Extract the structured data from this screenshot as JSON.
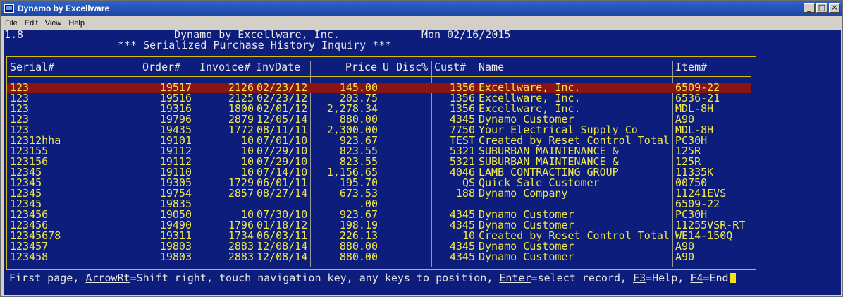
{
  "window": {
    "title": "Dynamo by Excellware",
    "icons": {
      "app": "terminal-app-icon",
      "minimize": "minimize-icon",
      "maximize": "maximize-icon",
      "close": "close-icon"
    },
    "buttons": {
      "minimize": "_",
      "maximize": "□",
      "close": "×"
    }
  },
  "menu": [
    {
      "label": "File"
    },
    {
      "label": "Edit"
    },
    {
      "label": "View"
    },
    {
      "label": "Help"
    }
  ],
  "screen": {
    "version": "1.8",
    "company": "Dynamo by Excellware, Inc.",
    "date": "Mon 02/16/2015",
    "heading": "*** Serialized Purchase History Inquiry ***"
  },
  "columns": {
    "serial": "Serial#",
    "order": "Order#",
    "invoice": "Invoice#",
    "invdate": "InvDate",
    "price": "Price",
    "u": "U",
    "disc": "Disc%",
    "cust": "Cust#",
    "name": "Name",
    "item": "Item#"
  },
  "rows": [
    {
      "serial": "123",
      "order": "19517",
      "invoice": "2126",
      "invdate": "02/23/12",
      "price": "145.00",
      "u": "",
      "disc": "",
      "cust": "1356",
      "name": "Excellware, Inc.",
      "item": "6509-22",
      "selected": true
    },
    {
      "serial": "123",
      "order": "19516",
      "invoice": "2125",
      "invdate": "02/23/12",
      "price": "203.75",
      "u": "",
      "disc": "",
      "cust": "1356",
      "name": "Excellware, Inc.",
      "item": "6536-21"
    },
    {
      "serial": "123",
      "order": "19316",
      "invoice": "1800",
      "invdate": "02/01/12",
      "price": "2,278.34",
      "u": "",
      "disc": "",
      "cust": "1356",
      "name": "Excellware, Inc.",
      "item": "MDL-8H"
    },
    {
      "serial": "123",
      "order": "19796",
      "invoice": "2879",
      "invdate": "12/05/14",
      "price": "880.00",
      "u": "",
      "disc": "",
      "cust": "4345",
      "name": "Dynamo Customer",
      "item": "A90"
    },
    {
      "serial": "123",
      "order": "19435",
      "invoice": "1772",
      "invdate": "08/11/11",
      "price": "2,300.00",
      "u": "",
      "disc": "",
      "cust": "7750",
      "name": "Your Electrical Supply Co",
      "item": "MDL-8H"
    },
    {
      "serial": "12312hha",
      "order": "19101",
      "invoice": "10",
      "invdate": "07/01/10",
      "price": "923.67",
      "u": "",
      "disc": "",
      "cust": "TEST",
      "name": "Created by Reset Control Total",
      "item": "PC30H"
    },
    {
      "serial": "123155",
      "order": "19112",
      "invoice": "10",
      "invdate": "07/29/10",
      "price": "823.55",
      "u": "",
      "disc": "",
      "cust": "5321",
      "name": "SUBURBAN MAINTENANCE &",
      "item": "125R"
    },
    {
      "serial": "123156",
      "order": "19112",
      "invoice": "10",
      "invdate": "07/29/10",
      "price": "823.55",
      "u": "",
      "disc": "",
      "cust": "5321",
      "name": "SUBURBAN MAINTENANCE &",
      "item": "125R"
    },
    {
      "serial": "12345",
      "order": "19110",
      "invoice": "10",
      "invdate": "07/14/10",
      "price": "1,156.65",
      "u": "",
      "disc": "",
      "cust": "4046",
      "name": "LAMB CONTRACTING GROUP",
      "item": "11335K"
    },
    {
      "serial": "12345",
      "order": "19305",
      "invoice": "1729",
      "invdate": "06/01/11",
      "price": "195.70",
      "u": "",
      "disc": "",
      "cust": "QS",
      "name": "Quick Sale Customer",
      "item": "00750"
    },
    {
      "serial": "12345",
      "order": "19754",
      "invoice": "2857",
      "invdate": "08/27/14",
      "price": "673.53",
      "u": "",
      "disc": "",
      "cust": "188",
      "name": "Dynamo Company",
      "item": "11241EVS"
    },
    {
      "serial": "12345",
      "order": "19835",
      "invoice": "",
      "invdate": "",
      "price": ".00",
      "u": "",
      "disc": "",
      "cust": "",
      "name": "",
      "item": "6509-22"
    },
    {
      "serial": "123456",
      "order": "19050",
      "invoice": "10",
      "invdate": "07/30/10",
      "price": "923.67",
      "u": "",
      "disc": "",
      "cust": "4345",
      "name": "Dynamo Customer",
      "item": "PC30H"
    },
    {
      "serial": "123456",
      "order": "19490",
      "invoice": "1796",
      "invdate": "01/18/12",
      "price": "198.19",
      "u": "",
      "disc": "",
      "cust": "4345",
      "name": "Dynamo Customer",
      "item": "11255VSR-RT"
    },
    {
      "serial": "12345678",
      "order": "19311",
      "invoice": "1734",
      "invdate": "06/03/11",
      "price": "226.13",
      "u": "",
      "disc": "",
      "cust": "10",
      "name": "Created by Reset Control Total",
      "item": "WE14-150Q"
    },
    {
      "serial": "123457",
      "order": "19803",
      "invoice": "2883",
      "invdate": "12/08/14",
      "price": "880.00",
      "u": "",
      "disc": "",
      "cust": "4345",
      "name": "Dynamo Customer",
      "item": "A90"
    },
    {
      "serial": "123458",
      "order": "19803",
      "invoice": "2883",
      "invdate": "12/08/14",
      "price": "880.00",
      "u": "",
      "disc": "",
      "cust": "4345",
      "name": "Dynamo Customer",
      "item": "A90"
    }
  ],
  "footer": {
    "t1": "First page, ",
    "k1": "ArrowRt",
    "t2": "=Shift right, touch navigation key, any keys to position, ",
    "k2": "Enter",
    "t3": "=select record, ",
    "k3": "F3",
    "t4": "=Help, ",
    "k4": "F4",
    "t5": "=End"
  }
}
